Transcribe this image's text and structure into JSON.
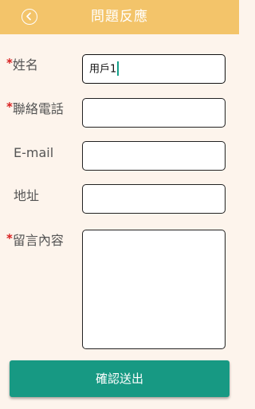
{
  "header": {
    "title": "問題反應",
    "back_icon": "circle-chevron-left-icon"
  },
  "form": {
    "name": {
      "label": "姓名",
      "required": true,
      "value": "用戶1"
    },
    "phone": {
      "label": "聯絡電話",
      "required": true,
      "value": ""
    },
    "email": {
      "label": "E-mail",
      "required": false,
      "value": ""
    },
    "address": {
      "label": "地址",
      "required": false,
      "value": ""
    },
    "message": {
      "label": "留言內容",
      "required": true,
      "value": ""
    },
    "required_mark": "*"
  },
  "submit": {
    "label": "確認送出"
  },
  "colors": {
    "header": "#f3c46a",
    "background": "#fdf4ec",
    "submit": "#179983",
    "required": "#d81e1e",
    "caret": "#16a08a"
  }
}
